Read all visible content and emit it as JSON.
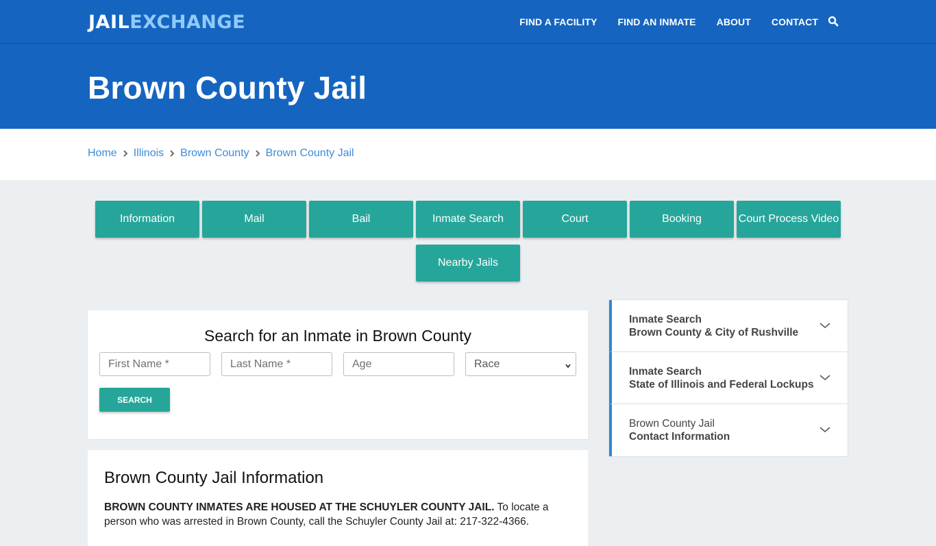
{
  "header": {
    "logo_part1": "JAIL",
    "logo_part2": "EXCHANGE",
    "nav": [
      {
        "label": "FIND A FACILITY"
      },
      {
        "label": "FIND AN INMATE"
      },
      {
        "label": "ABOUT"
      },
      {
        "label": "CONTACT"
      }
    ],
    "search_icon": "search-icon"
  },
  "hero": {
    "title": "Brown County Jail"
  },
  "breadcrumb": [
    {
      "label": "Home"
    },
    {
      "label": "Illinois"
    },
    {
      "label": "Brown County"
    },
    {
      "label": "Brown County Jail"
    }
  ],
  "tabs": [
    {
      "label": "Information"
    },
    {
      "label": "Mail"
    },
    {
      "label": "Bail"
    },
    {
      "label": "Inmate Search"
    },
    {
      "label": "Court"
    },
    {
      "label": "Booking"
    },
    {
      "label": "Court Process Video"
    },
    {
      "label": "Nearby Jails"
    }
  ],
  "search_form": {
    "title": "Search for an Inmate in Brown County",
    "first_name_placeholder": "First Name *",
    "last_name_placeholder": "Last Name *",
    "age_placeholder": "Age",
    "race_selected": "Race",
    "search_label": "SEARCH"
  },
  "info": {
    "heading": "Brown County Jail Information",
    "bold_text": "BROWN COUNTY INMATES ARE HOUSED AT THE SCHUYLER COUNTY JAIL.",
    "body_text": " To locate a person who was arrested in Brown County, call the Schuyler County Jail at: 217-322-4366."
  },
  "sidebar": {
    "items": [
      {
        "line1": "Inmate Search",
        "line2": "Brown County & City of Rushville"
      },
      {
        "line1": "Inmate Search",
        "line2": "State of Illinois and Federal Lockups"
      },
      {
        "line1": "Brown County Jail",
        "line2": "Contact Information"
      }
    ]
  },
  "colors": {
    "brand_blue": "#1565c0",
    "logo_accent": "#90caf9",
    "teal_button": "#26a69a",
    "link_blue": "#3d8bd8",
    "accordion_accent": "#2f86d6"
  }
}
